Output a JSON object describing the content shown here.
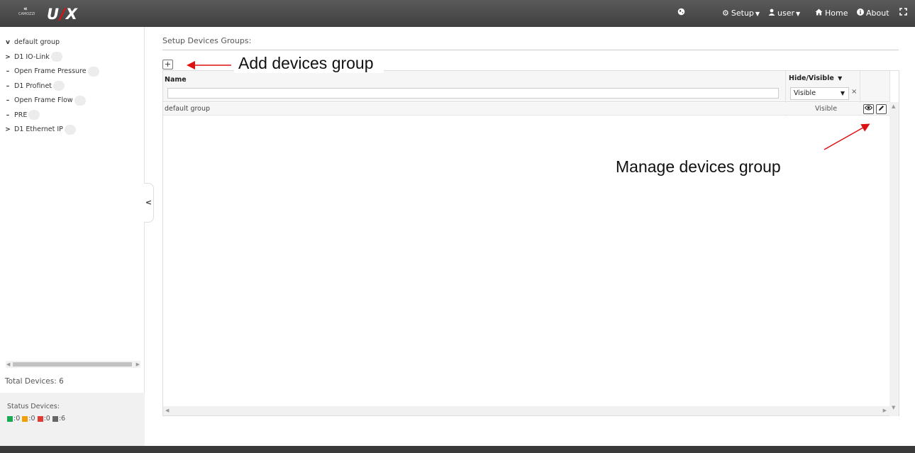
{
  "app": {
    "brand_main": "U",
    "brand_accent": "X",
    "logo_text": "CAMOZZI"
  },
  "topnav": {
    "globe_icon": "globe-icon",
    "setup_label": "Setup",
    "user_label": "user",
    "home_label": "Home",
    "about_label": "About",
    "fullscreen_icon": "fullscreen-icon"
  },
  "sidebar": {
    "tree": [
      {
        "label": "default group",
        "toggle": "v"
      },
      {
        "label": "D1 IO-Link",
        "toggle": ">"
      },
      {
        "label": "Open Frame Pressure",
        "toggle": "–"
      },
      {
        "label": "D1 Profinet",
        "toggle": "–"
      },
      {
        "label": "Open Frame Flow",
        "toggle": "–"
      },
      {
        "label": "PRE",
        "toggle": "–"
      },
      {
        "label": "D1 Ethernet IP",
        "toggle": ">"
      }
    ],
    "total_devices": "Total Devices: 6",
    "status_title": "Status Devices:",
    "status_counts": [
      ":0",
      ":0",
      ":0",
      ":6"
    ],
    "status_colors": [
      "#1aaa55",
      "#f0a000",
      "#e03c31",
      "#666666"
    ]
  },
  "main": {
    "title": "Setup Devices Groups:",
    "add_icon": "+",
    "columns": {
      "name": "Name",
      "visibility": "Hide/Visible"
    },
    "filter_visibility": "Visible",
    "clear_filter": "×",
    "rows": [
      {
        "name": "default group",
        "visibility": "Visible"
      }
    ]
  },
  "annotations": {
    "add_group": "Add devices group",
    "manage_group": "Manage devices group"
  },
  "colors": {
    "accent": "#dd1111",
    "topbar": "#4a4a4a"
  }
}
